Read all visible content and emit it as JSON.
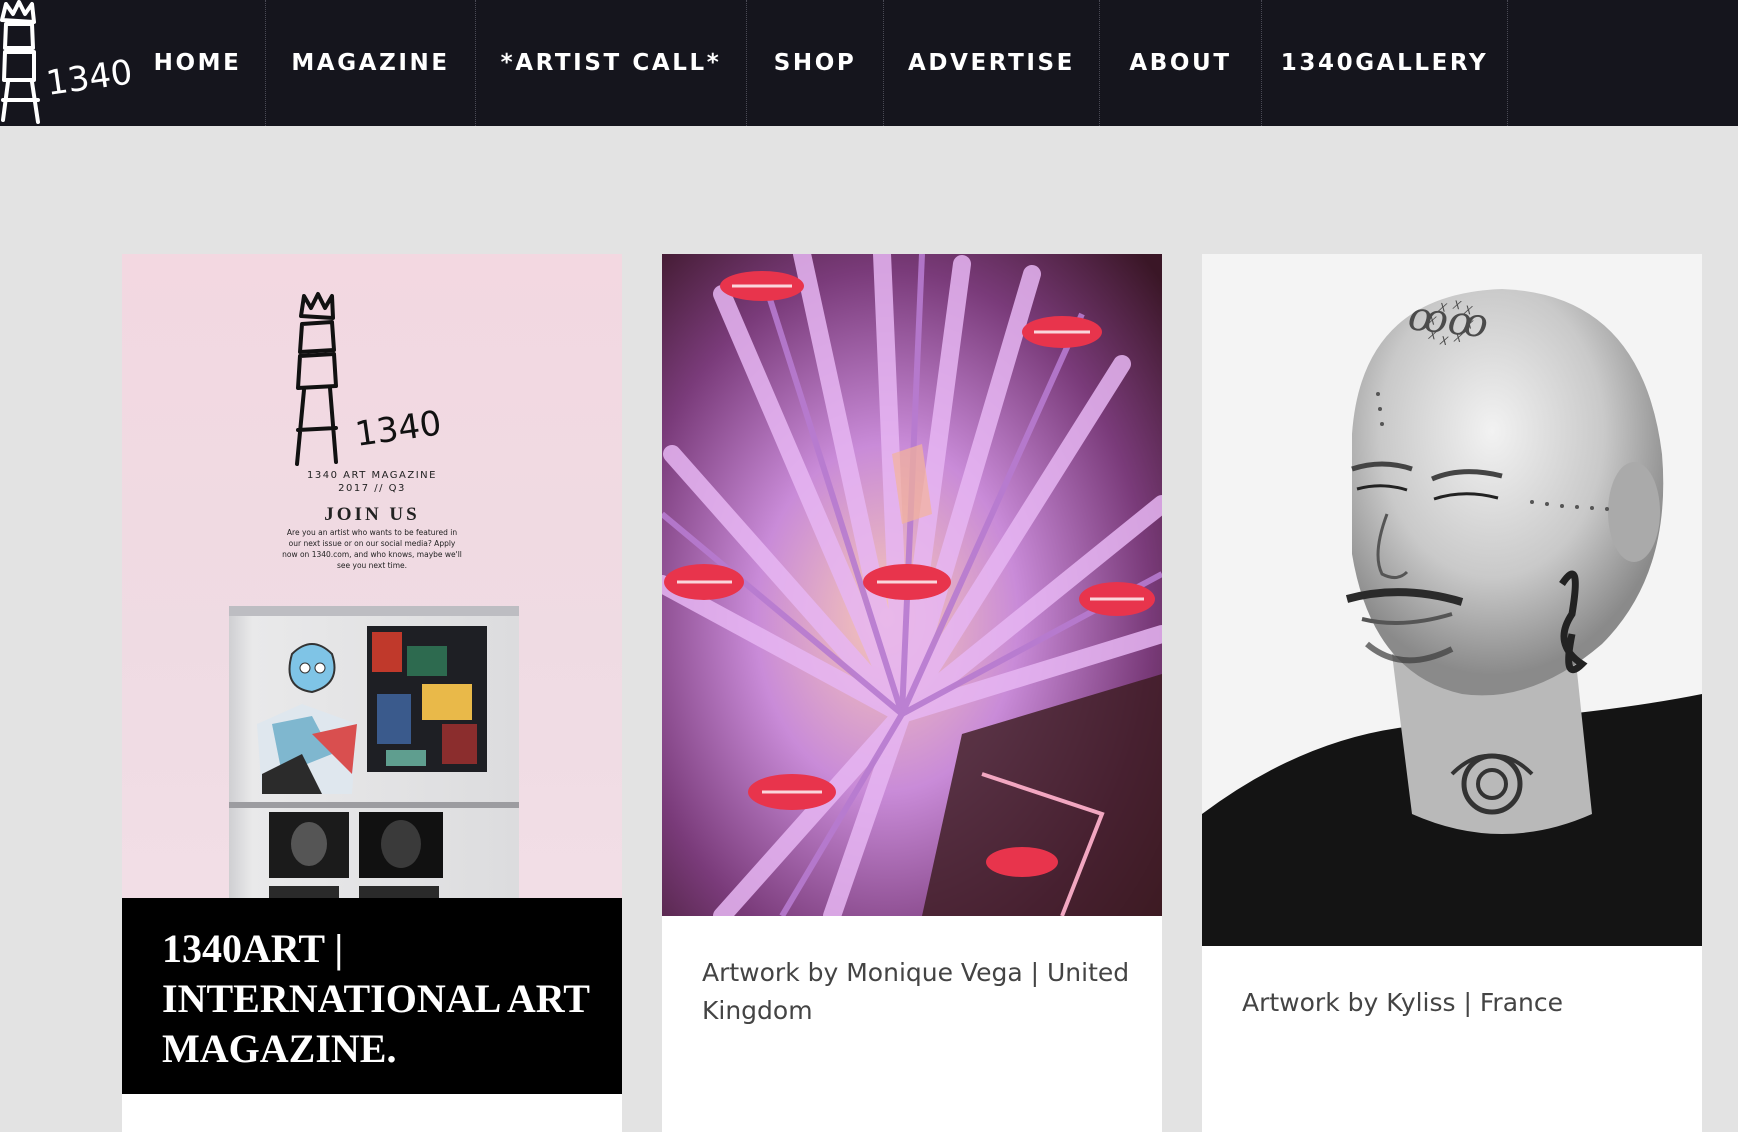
{
  "nav": {
    "logo_text": "1340",
    "items": [
      {
        "label": "HOME"
      },
      {
        "label": "MAGAZINE"
      },
      {
        "label": "*ARTIST CALL*"
      },
      {
        "label": "SHOP"
      },
      {
        "label": "ADVERTISE"
      },
      {
        "label": "ABOUT"
      },
      {
        "label": "1340GALLERY"
      }
    ]
  },
  "cards": [
    {
      "poster": {
        "logo_text": "1340",
        "magazine": "1340 ART MAGAZINE",
        "issue": "2017 // Q3",
        "heading": "JOIN US",
        "body": "Are you an artist who wants to be featured in our next issue or on our social media? Apply now on 1340.com, and who knows, maybe we'll see you next time."
      },
      "title": "1340ART | INTERNATIONAL ART MAGAZINE."
    },
    {
      "image": "kaleidoscope-lips-artwork",
      "caption": "Artwork by Monique Vega | United Kingdom"
    },
    {
      "image": "tattooed-man-portrait-drawing",
      "caption": "Artwork by Kyliss | France"
    }
  ],
  "colors": {
    "nav_bg": "#15151d",
    "page_bg": "#e3e3e3",
    "title_box_bg": "#000000",
    "caption_text": "#444444"
  }
}
